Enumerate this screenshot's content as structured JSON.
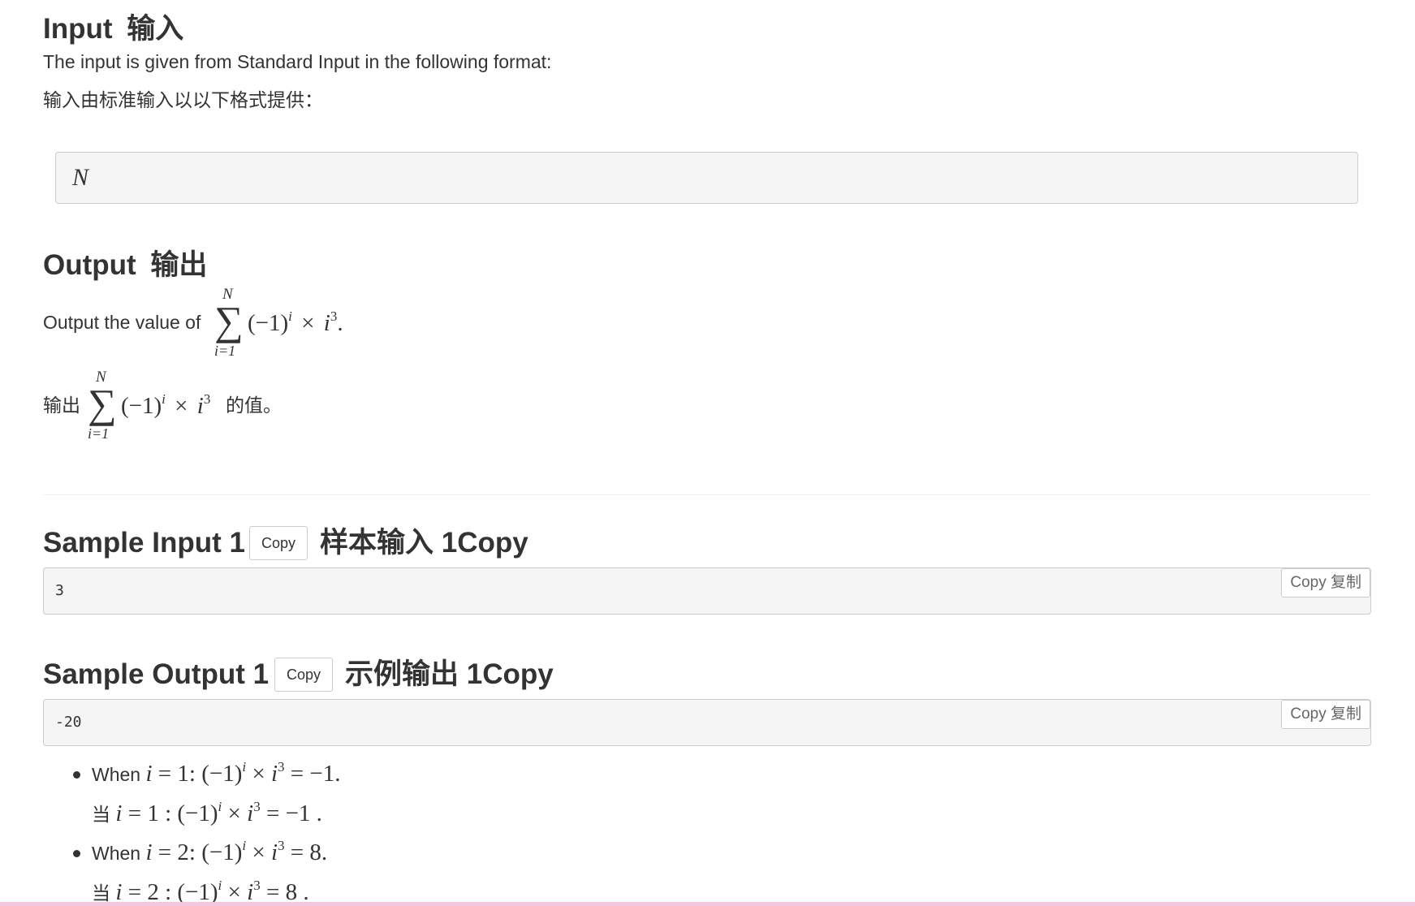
{
  "input_section": {
    "title_en": "Input",
    "title_cn": "输入",
    "desc_en": "The input is given from Standard Input in the following format:",
    "desc_cn": "输入由标准输入以以下格式提供：",
    "format_var": "N"
  },
  "output_section": {
    "title_en": "Output",
    "title_cn": "输出",
    "desc_en_prefix": "Output the value of",
    "desc_cn_prefix": "输出",
    "desc_cn_suffix": "的值。",
    "sum_upper": "N",
    "sum_lower": "i=1",
    "expr_base": "(−1)",
    "expr_exp": "i",
    "expr_times": "×",
    "expr_var": "i",
    "expr_pow": "3",
    "period": "."
  },
  "sample_input": {
    "title_en": "Sample Input 1",
    "copy_label": "Copy",
    "title_cn": "样本输入 1Copy",
    "code": "3",
    "copy_cn_label": "Copy 复制"
  },
  "sample_output": {
    "title_en": "Sample Output 1",
    "copy_label": "Copy",
    "title_cn": "示例输出 1Copy",
    "code": "-20",
    "copy_cn_label": "Copy 复制"
  },
  "explanations": [
    {
      "en_prefix": "When",
      "cn_prefix": "当",
      "i_value": "1",
      "result": "−1"
    },
    {
      "en_prefix": "When",
      "cn_prefix": "当",
      "i_value": "2",
      "result": "8"
    }
  ],
  "colors": {
    "text": "#333333",
    "box_bg": "#f5f5f5",
    "box_border": "#cccccc",
    "bottom_bar": "#f3c7dd"
  }
}
